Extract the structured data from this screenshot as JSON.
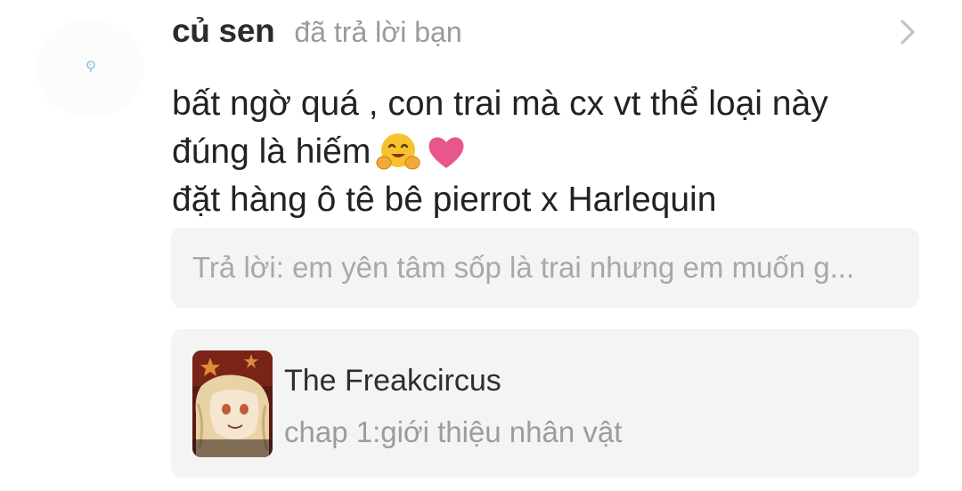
{
  "notification": {
    "username": "củ sen",
    "action_text": "đã trả lời bạn",
    "avatar_icon": "avatar-placeholder-icon",
    "open_icon": "chevron-right-icon"
  },
  "comment": {
    "line1": "bất ngờ quá , con trai mà cx vt thể loại này",
    "line2": "đúng là hiếm",
    "line2_emojis": [
      "hugging-face-emoji",
      "heart-emoji"
    ],
    "line3": "đặt hàng ô tê bê pierrot x Harlequin"
  },
  "reply_preview": {
    "text": "Trả lời: em yên tâm sốp là trai nhưng em muốn g..."
  },
  "story": {
    "title": "The Freakcircus",
    "chapter": "chap 1:giới thiệu nhân vật",
    "cover_icon": "story-cover-image"
  },
  "colors": {
    "username": "#2b2b2b",
    "muted": "#9a9a9a",
    "card_bg": "#f4f4f4",
    "heart": "#e8568c",
    "emoji_face": "#f7c22e"
  }
}
